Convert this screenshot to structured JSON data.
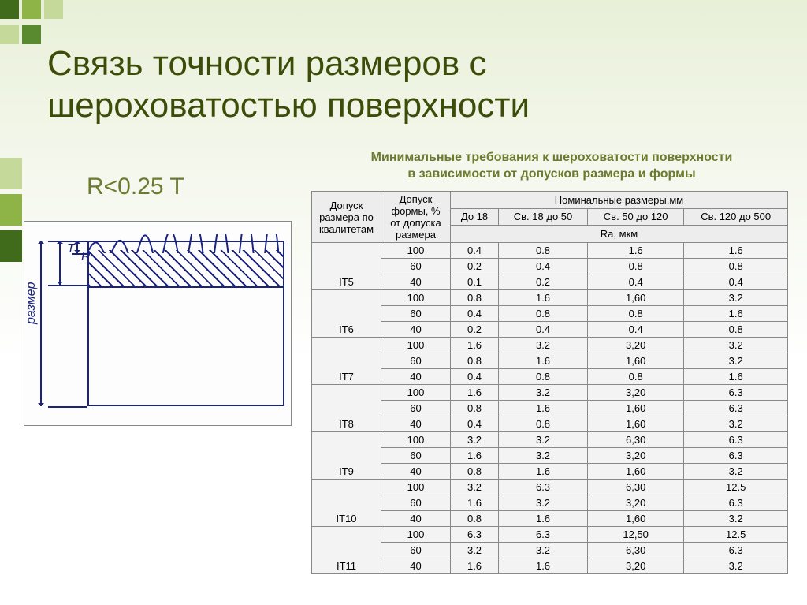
{
  "title_line1": "Связь точности размеров с",
  "title_line2": "шероховатостью поверхности",
  "subtitle_line1": "Минимальные требования к шероховатости поверхности",
  "subtitle_line2": "в зависимости от допусков размера и формы",
  "formula": "R<0.25 T",
  "diagram": {
    "label_T": "T",
    "label_R": "R",
    "label_size": "размер"
  },
  "headers": {
    "col_it": "Допуск размера по квалитетам",
    "col_form": "Допуск формы, % от допуска размера",
    "nominal": "Номинальные размеры,мм",
    "range1": "До 18",
    "range2": "Св. 18 до 50",
    "range3": "Св. 50 до 120",
    "range4": "Св. 120 до 500",
    "ra": "Ra, мкм"
  },
  "groups": [
    {
      "it": "IT5",
      "rows": [
        {
          "pct": "100",
          "v": [
            "0.4",
            "0.8",
            "1.6",
            "1.6"
          ]
        },
        {
          "pct": "60",
          "v": [
            "0.2",
            "0.4",
            "0.8",
            "0.8"
          ]
        },
        {
          "pct": "40",
          "v": [
            "0.1",
            "0.2",
            "0.4",
            "0.4"
          ]
        }
      ]
    },
    {
      "it": "IT6",
      "rows": [
        {
          "pct": "100",
          "v": [
            "0.8",
            "1.6",
            "1,60",
            "3.2"
          ]
        },
        {
          "pct": "60",
          "v": [
            "0.4",
            "0.8",
            "0.8",
            "1.6"
          ]
        },
        {
          "pct": "40",
          "v": [
            "0.2",
            "0.4",
            "0.4",
            "0.8"
          ]
        }
      ]
    },
    {
      "it": "IT7",
      "rows": [
        {
          "pct": "100",
          "v": [
            "1.6",
            "3.2",
            "3,20",
            "3.2"
          ]
        },
        {
          "pct": "60",
          "v": [
            "0.8",
            "1.6",
            "1,60",
            "3.2"
          ]
        },
        {
          "pct": "40",
          "v": [
            "0.4",
            "0.8",
            "0.8",
            "1.6"
          ]
        }
      ]
    },
    {
      "it": "IT8",
      "rows": [
        {
          "pct": "100",
          "v": [
            "1.6",
            "3.2",
            "3,20",
            "6.3"
          ]
        },
        {
          "pct": "60",
          "v": [
            "0.8",
            "1.6",
            "1,60",
            "6.3"
          ]
        },
        {
          "pct": "40",
          "v": [
            "0.4",
            "0.8",
            "1,60",
            "3.2"
          ]
        }
      ]
    },
    {
      "it": "IT9",
      "rows": [
        {
          "pct": "100",
          "v": [
            "3.2",
            "3.2",
            "6,30",
            "6.3"
          ]
        },
        {
          "pct": "60",
          "v": [
            "1.6",
            "3.2",
            "3,20",
            "6.3"
          ]
        },
        {
          "pct": "40",
          "v": [
            "0.8",
            "1.6",
            "1,60",
            "3.2"
          ]
        }
      ]
    },
    {
      "it": "IT10",
      "rows": [
        {
          "pct": "100",
          "v": [
            "3.2",
            "6.3",
            "6,30",
            "12.5"
          ]
        },
        {
          "pct": "60",
          "v": [
            "1.6",
            "3.2",
            "3,20",
            "6.3"
          ]
        },
        {
          "pct": "40",
          "v": [
            "0.8",
            "1.6",
            "1,60",
            "3.2"
          ]
        }
      ]
    },
    {
      "it": "IT11",
      "rows": [
        {
          "pct": "100",
          "v": [
            "6.3",
            "6.3",
            "12,50",
            "12.5"
          ]
        },
        {
          "pct": "60",
          "v": [
            "3.2",
            "3.2",
            "6,30",
            "6.3"
          ]
        },
        {
          "pct": "40",
          "v": [
            "1.6",
            "1.6",
            "3,20",
            "3.2"
          ]
        }
      ]
    }
  ]
}
